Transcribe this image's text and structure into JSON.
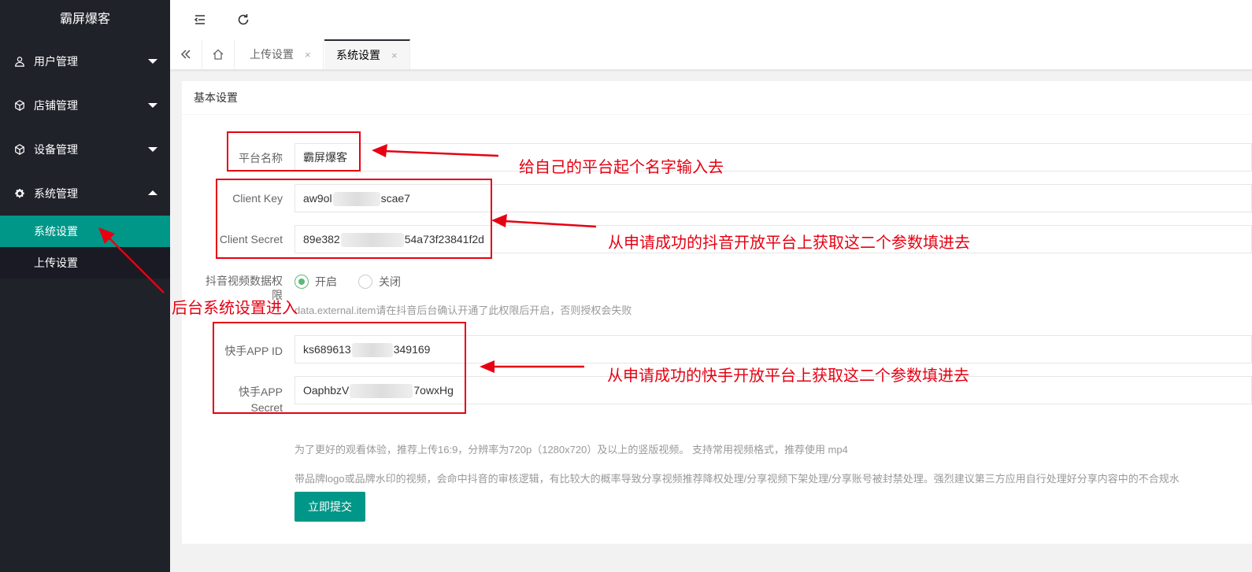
{
  "app": {
    "title": "霸屏爆客"
  },
  "sidebar": {
    "items": [
      {
        "label": "用户管理",
        "icon": "user-icon",
        "expanded": false
      },
      {
        "label": "店铺管理",
        "icon": "shop-icon",
        "expanded": false
      },
      {
        "label": "设备管理",
        "icon": "device-icon",
        "expanded": false
      },
      {
        "label": "系统管理",
        "icon": "gear-icon",
        "expanded": true
      }
    ],
    "submenu": [
      {
        "label": "系统设置",
        "active": true
      },
      {
        "label": "上传设置",
        "active": false
      }
    ]
  },
  "header": {
    "menu_icon": "fold-menu-icon",
    "refresh_icon": "refresh-icon"
  },
  "tabs": {
    "home_icon": "home-icon",
    "items": [
      {
        "label": "上传设置",
        "active": false
      },
      {
        "label": "系统设置",
        "active": true
      }
    ],
    "close_glyph": "×"
  },
  "card": {
    "title": "基本设置",
    "fields": {
      "platform_name": {
        "label": "平台名称",
        "value": "霸屏爆客"
      },
      "client_key": {
        "label": "Client Key",
        "value_start": "aw9ol",
        "value_end": "scae7"
      },
      "client_secret": {
        "label": "Client Secret",
        "value_start": "89e382",
        "value_end": "54a73f23841f2d"
      },
      "permission": {
        "label_line1": "抖音视频数据权",
        "label_line2": "限",
        "option_on": "开启",
        "option_off": "关闭",
        "selected": "开启",
        "tip": "data.external.item请在抖音后台确认开通了此权限后开启，否则授权会失败"
      },
      "ks_app_id": {
        "label": "快手APP ID",
        "value_start": "ks689613",
        "value_end": "349169"
      },
      "ks_app_secret": {
        "label_line1": "快手APP",
        "label_line2": "Secret",
        "value_start": "OaphbzV",
        "value_end": "7owxHg"
      }
    },
    "tip1": "为了更好的观看体验，推荐上传16:9，分辨率为720p（1280x720）及以上的竖版视频。   支持常用视频格式，推荐使用 mp4",
    "tip2": "带品牌logo或品牌水印的视频，会命中抖音的审核逻辑，有比较大的概率导致分享视频推荐降权处理/分享视频下架处理/分享账号被封禁处理。强烈建议第三方应用自行处理好分享内容中的不合规水",
    "submit_label": "立即提交"
  },
  "annotations": {
    "note_platform": "给自己的平台起个名字输入去",
    "note_douyin": "从申请成功的抖音开放平台上获取这二个参数填进去",
    "note_kuaishou": "从申请成功的快手开放平台上获取这二个参数填进去",
    "note_entry": "后台系统设置进入",
    "color": "#e60012"
  },
  "colors": {
    "sidebar_bg": "#20222a",
    "active": "#009688",
    "radio_on": "#5FB878"
  }
}
